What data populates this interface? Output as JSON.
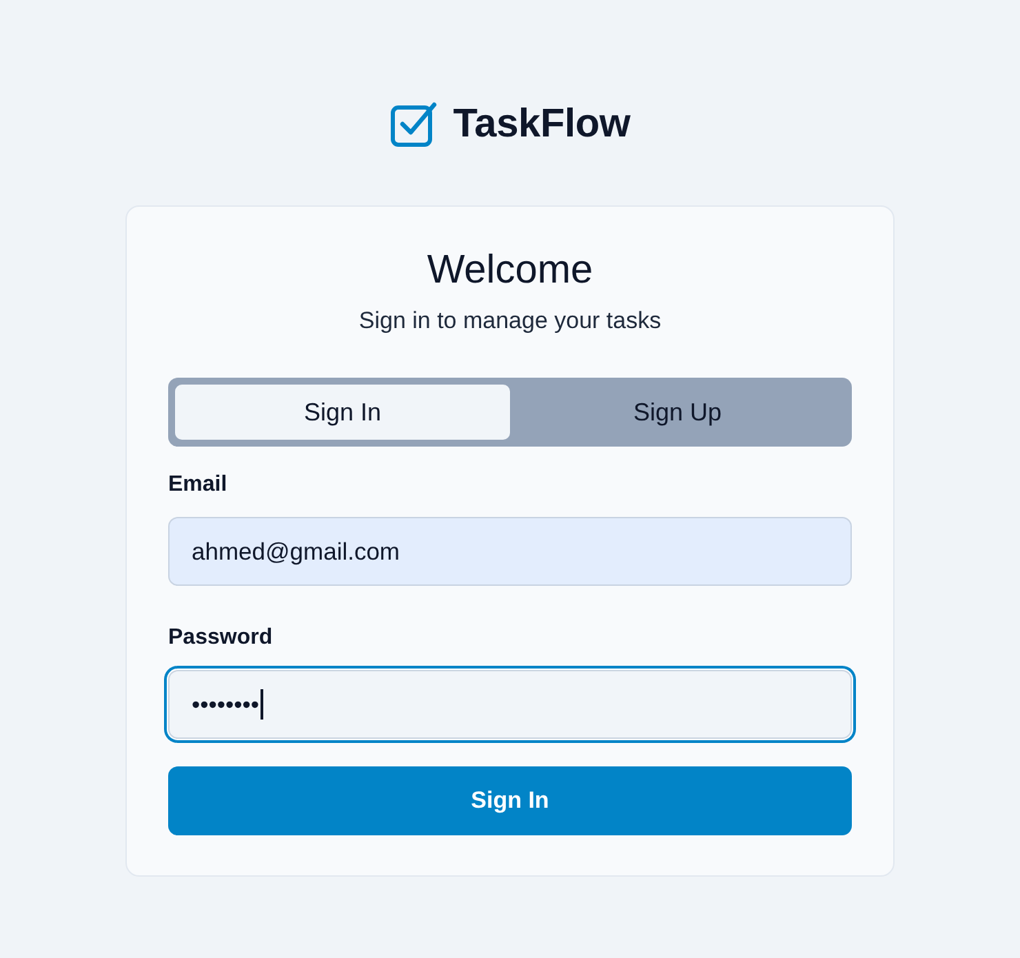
{
  "brand": {
    "name": "TaskFlow"
  },
  "card": {
    "title": "Welcome",
    "subtitle": "Sign in to manage your tasks"
  },
  "tabs": [
    {
      "label": "Sign In",
      "selected": true
    },
    {
      "label": "Sign Up",
      "selected": false
    }
  ],
  "fields": [
    {
      "label": "Email",
      "value": "ahmed@gmail.com",
      "autofilled": true,
      "focused": false
    },
    {
      "label": "Password",
      "value": "••••••••",
      "autofilled": false,
      "focused": true
    }
  ],
  "submit": {
    "label": "Sign In"
  }
}
